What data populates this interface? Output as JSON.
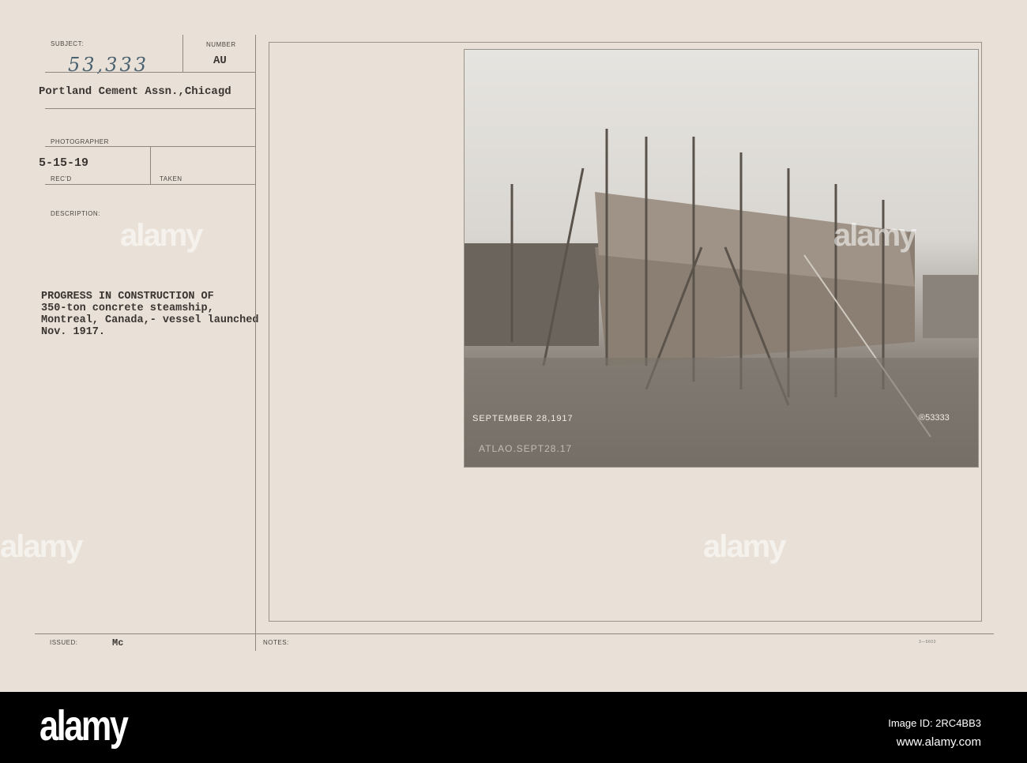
{
  "card": {
    "subject_label": "SUBJECT:",
    "subject_number": "53,333",
    "number_label": "NUMBER",
    "number_value": "AU",
    "source": "Portland Cement Assn.,Chicagd",
    "photographer_label": "PHOTOGRAPHER",
    "recd_value": "5-15-19",
    "recd_label": "REC'D",
    "taken_label": "TAKEN",
    "description_label": "DESCRIPTION:",
    "description": "PROGRESS IN CONSTRUCTION OF\n350-ton concrete steamship,\nMontreal, Canada,- vessel launched\nNov. 1917.",
    "issued_label": "ISSUED:",
    "issued_value": "Mc",
    "notes_label": "NOTES:",
    "form_number": "3—5603"
  },
  "photo": {
    "caption_date": "SEPTEMBER 28,1917",
    "caption_scratch": "ATLAO.SEPT28.17",
    "photo_number": "®53333"
  },
  "watermark": {
    "text": "alamy"
  },
  "footer": {
    "logo": "alamy",
    "image_id": "Image ID: 2RC4BB3",
    "url": "www.alamy.com"
  }
}
